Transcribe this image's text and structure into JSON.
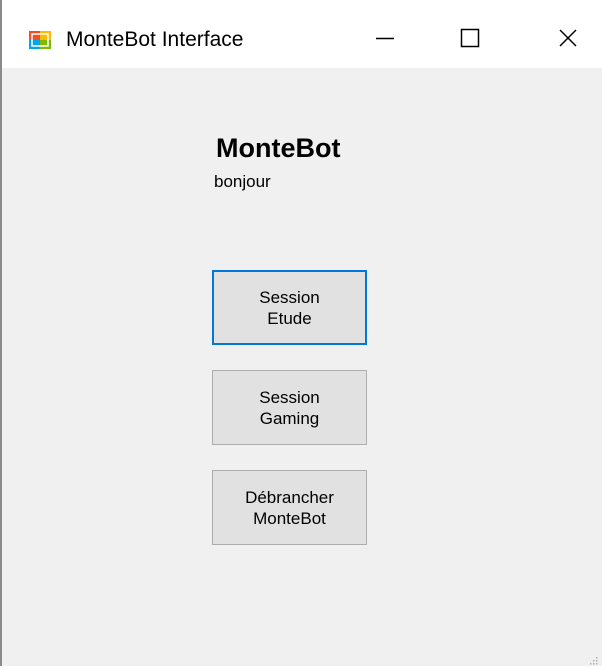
{
  "window": {
    "title": "MonteBot Interface",
    "icon": "windows-forms-app-icon"
  },
  "titlebar_buttons": {
    "minimize_icon": "minimize-icon",
    "maximize_icon": "maximize-icon",
    "close_icon": "close-icon"
  },
  "main": {
    "heading": "MonteBot",
    "subtext": "bonjour",
    "buttons": [
      {
        "label": "Session\nEtude",
        "focused": true
      },
      {
        "label": "Session\nGaming",
        "focused": false
      },
      {
        "label": "Débrancher\nMonteBot",
        "focused": false
      }
    ]
  },
  "colors": {
    "client_background": "#f0f0f0",
    "button_background": "#e1e1e1",
    "button_border": "#adadad",
    "focus_border": "#0078d7"
  }
}
